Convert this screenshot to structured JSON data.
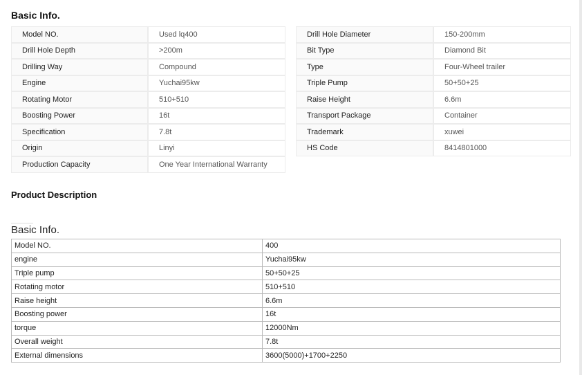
{
  "basic_info": {
    "title": "Basic Info.",
    "left": [
      {
        "label": "Model NO.",
        "value": "Used lq400"
      },
      {
        "label": "Drill Hole Depth",
        "value": ">200m"
      },
      {
        "label": "Drilling Way",
        "value": "Compound"
      },
      {
        "label": "Engine",
        "value": "Yuchai95kw"
      },
      {
        "label": "Rotating Motor",
        "value": "510+510"
      },
      {
        "label": "Boosting Power",
        "value": "16t"
      },
      {
        "label": "Specification",
        "value": "7.8t"
      },
      {
        "label": "Origin",
        "value": "Linyi"
      },
      {
        "label": "Production Capacity",
        "value": "One Year International Warranty"
      }
    ],
    "right": [
      {
        "label": "Drill Hole Diameter",
        "value": "150-200mm"
      },
      {
        "label": "Bit Type",
        "value": "Diamond Bit"
      },
      {
        "label": "Type",
        "value": "Four-Wheel trailer"
      },
      {
        "label": "Triple Pump",
        "value": "50+50+25"
      },
      {
        "label": "Raise Height",
        "value": "6.6m"
      },
      {
        "label": "Transport Package",
        "value": "Container"
      },
      {
        "label": "Trademark",
        "value": "xuwei"
      },
      {
        "label": "HS Code",
        "value": "8414801000"
      }
    ]
  },
  "product_description": {
    "title": "Product Description",
    "subtitle": "Basic Info.",
    "rows": [
      {
        "label": "Model NO.",
        "value": "400"
      },
      {
        "label": "engine",
        "value": "Yuchai95kw"
      },
      {
        "label": "Triple pump",
        "value": "50+50+25"
      },
      {
        "label": "Rotating motor",
        "value": "510+510"
      },
      {
        "label": "Raise height",
        "value": "6.6m"
      },
      {
        "label": "Boosting power",
        "value": "16t"
      },
      {
        "label": "torque",
        "value": "12000Nm"
      },
      {
        "label": "Overall weight",
        "value": "7.8t"
      },
      {
        "label": "External dimensions",
        "value": "3600(5000)+1700+2250"
      }
    ]
  }
}
